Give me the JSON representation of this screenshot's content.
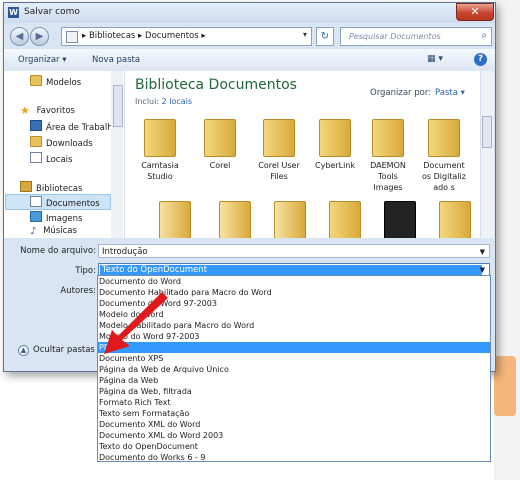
{
  "window": {
    "title": "Salvar como",
    "close_label": "✕"
  },
  "nav": {
    "back_icon": "◀",
    "forward_icon": "▶",
    "address_path": "▸ Bibliotecas ▸ Documentos ▸",
    "address_dropdown": "▾",
    "refresh_icon": "↻",
    "search_placeholder": "Pesquisar Documentos",
    "search_icon": "⌕"
  },
  "toolbar": {
    "organize_label": "Organizar ▾",
    "new_folder_label": "Nova pasta",
    "views_label": "▦ ▾",
    "help_label": "?"
  },
  "sidebar": {
    "items": [
      {
        "label": "Modelos",
        "icon": "folder-icon"
      },
      {
        "label": "Favoritos",
        "icon": "star-icon"
      },
      {
        "label": "Área de Trabalho",
        "icon": "desktop-icon"
      },
      {
        "label": "Downloads",
        "icon": "downloads-icon"
      },
      {
        "label": "Locais",
        "icon": "recent-places-icon"
      },
      {
        "label": "Bibliotecas",
        "icon": "libraries-icon"
      },
      {
        "label": "Documentos",
        "icon": "documents-icon"
      },
      {
        "label": "Imagens",
        "icon": "pictures-icon"
      },
      {
        "label": "Músicas",
        "icon": "music-icon"
      }
    ]
  },
  "library": {
    "title": "Biblioteca Documentos",
    "includes_label": "Inclui:",
    "includes_link": "2 locais",
    "arrange_label": "Organizar por:",
    "arrange_value": "Pasta ▾"
  },
  "folders": [
    {
      "label": "Camtasia Studio"
    },
    {
      "label": "Corel"
    },
    {
      "label": "Corel User Files"
    },
    {
      "label": "CyberLink"
    },
    {
      "label": "DAEMON Tools Images"
    },
    {
      "label": "Document os Digitalizado s"
    }
  ],
  "form": {
    "filename_label": "Nome do arquivo:",
    "filename_value": "Introdução",
    "type_label": "Tipo:",
    "type_value": "Texto do OpenDocument",
    "authors_label": "Autores:",
    "hide_folders_label": "Ocultar pastas",
    "hide_folders_icon": "▲"
  },
  "type_options": [
    "Documento do Word",
    "Documento Habilitado para Macro do Word",
    "Documento do Word 97-2003",
    "Modelo do Word",
    "Modelo Habilitado para Macro do Word",
    "Modelo do Word 97-2003",
    "PDF",
    "Documento XPS",
    "Página da Web de Arquivo Único",
    "Página da Web",
    "Página da Web, filtrada",
    "Formato Rich Text",
    "Texto sem Formatação",
    "Documento XML do Word",
    "Documento XML do Word 2003",
    "Texto do OpenDocument",
    "Documento do Works 6 - 9"
  ],
  "selected_option_index": 6,
  "colors": {
    "selection": "#3399ff",
    "library_title": "#1f6a35",
    "annotation_arrow": "#e0191c"
  }
}
